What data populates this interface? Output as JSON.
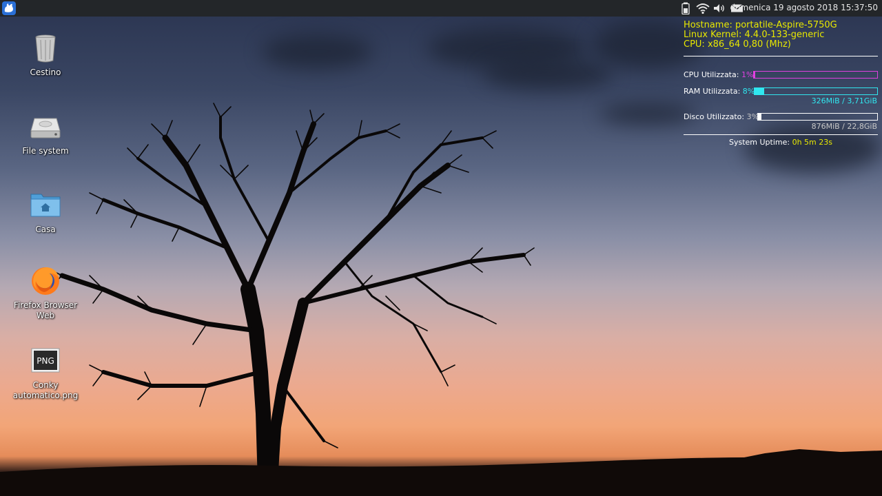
{
  "panel": {
    "clock": "domenica 19 agosto 2018 15:37:50",
    "tray_icons": [
      "battery-icon",
      "wifi-icon",
      "volume-icon",
      "mail-icon"
    ]
  },
  "desktop_icons": [
    {
      "label": "Cestino",
      "icon": "trash-icon"
    },
    {
      "label": "File system",
      "icon": "drive-icon"
    },
    {
      "label": "Casa",
      "icon": "home-folder-icon"
    },
    {
      "label": "Firefox Browser Web",
      "icon": "firefox-icon"
    },
    {
      "label": "Conky automatico.png",
      "icon": "png-file-icon"
    }
  ],
  "png_badge": "PNG",
  "conky": {
    "hostname": "Hostname: portatile-Aspire-5750G",
    "kernel": "Linux Kernel: 4.4.0-133-generic",
    "cpu_info": "CPU: x86_64  0,80 (Mhz)",
    "cpu_label": "CPU Utilizzata:",
    "cpu_value": "1%",
    "cpu_fraction": 0.01,
    "ram_label": "RAM Utilizzata:",
    "ram_value": "8%",
    "ram_fraction": 0.08,
    "ram_detail": "326MiB / 3,71GiB",
    "disk_label": "Disco Utilizzato:",
    "disk_value": "3%",
    "disk_fraction": 0.03,
    "disk_detail": "876MiB / 22,8GiB",
    "uptime_label": "System Uptime:",
    "uptime_value": "0h 5m 23s",
    "colors": {
      "yellow": "#e8e800",
      "cpu": "#e040e0",
      "ram": "#30e8f0",
      "disk": "#ffffff",
      "disk_text": "#c8c8c8"
    }
  }
}
